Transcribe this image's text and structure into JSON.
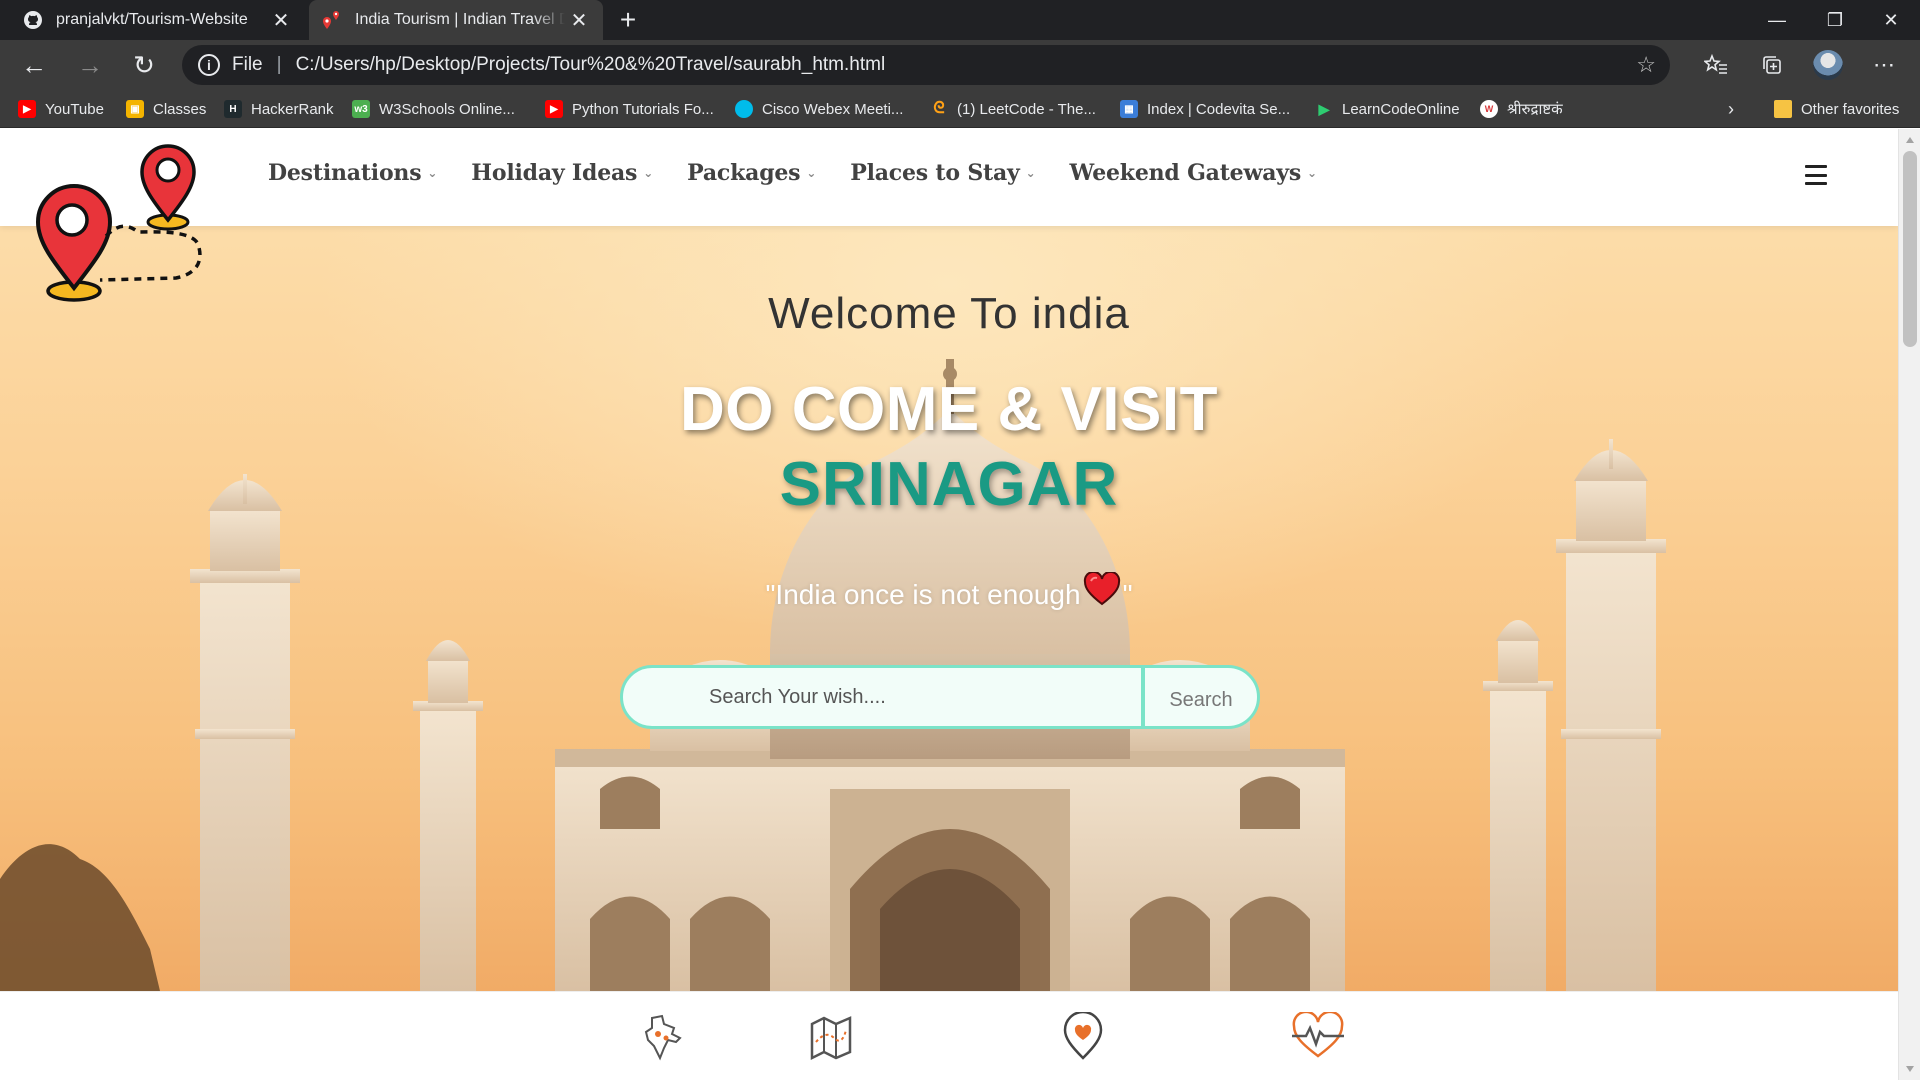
{
  "browser": {
    "tabs": [
      {
        "title": "pranjalvkt/Tourism-Website",
        "active": false,
        "icon": "github-icon"
      },
      {
        "title": "India Tourism | Indian Travel Destinations",
        "active": true,
        "icon": "map-pin-icon"
      }
    ],
    "new_tab": "+",
    "window_controls": {
      "minimize": "—",
      "restore": "❐",
      "close": "✕"
    },
    "address": {
      "scheme": "File",
      "url": "C:/Users/hp/Desktop/Projects/Tour%20&%20Travel/saurabh_htm.html"
    },
    "bookmarks": [
      {
        "label": "YouTube",
        "icon": "youtube-icon",
        "color": "#ff0000"
      },
      {
        "label": "Classes",
        "icon": "classroom-icon",
        "color": "#f4b400"
      },
      {
        "label": "HackerRank",
        "icon": "hackerrank-icon",
        "color": "#1ba94c"
      },
      {
        "label": "W3Schools Online...",
        "icon": "w3schools-icon",
        "color": "#4caf50"
      },
      {
        "label": "Python Tutorials Fo...",
        "icon": "youtube-icon",
        "color": "#ff0000"
      },
      {
        "label": "Cisco Webex Meeti...",
        "icon": "webex-icon",
        "color": "#00bceb"
      },
      {
        "label": "(1) LeetCode - The...",
        "icon": "leetcode-icon",
        "color": "#ffa116"
      },
      {
        "label": "Index | Codevita Se...",
        "icon": "codevita-icon",
        "color": "#3b7dd8"
      },
      {
        "label": "LearnCodeOnline",
        "icon": "learncodeonline-icon",
        "color": "#2ecc71"
      },
      {
        "label": "श्रीरुद्राष्टकं",
        "icon": "wordpress-icon",
        "color": "#d63638"
      }
    ],
    "other_favorites": "Other favorites"
  },
  "site": {
    "menu": [
      {
        "label": "Destinations"
      },
      {
        "label": "Holiday Ideas"
      },
      {
        "label": "Packages"
      },
      {
        "label": "Places to Stay"
      },
      {
        "label": "Weekend Gateways"
      }
    ],
    "hero": {
      "welcome": "Welcome To india",
      "headline": "DO COME & VISIT",
      "city": "SRINAGAR",
      "quote_before": "\"India once is not enough",
      "quote_after": "\""
    },
    "search": {
      "placeholder": "Search Your wish....",
      "button": "Search"
    },
    "features": [
      {
        "icon": "india-map-icon"
      },
      {
        "icon": "folded-map-icon"
      },
      {
        "icon": "location-heart-icon"
      },
      {
        "icon": "heartbeat-icon"
      }
    ],
    "colors": {
      "accent": "#1a9a84",
      "search_border": "#7be3c8",
      "feature_icon": "#e8702a"
    }
  }
}
